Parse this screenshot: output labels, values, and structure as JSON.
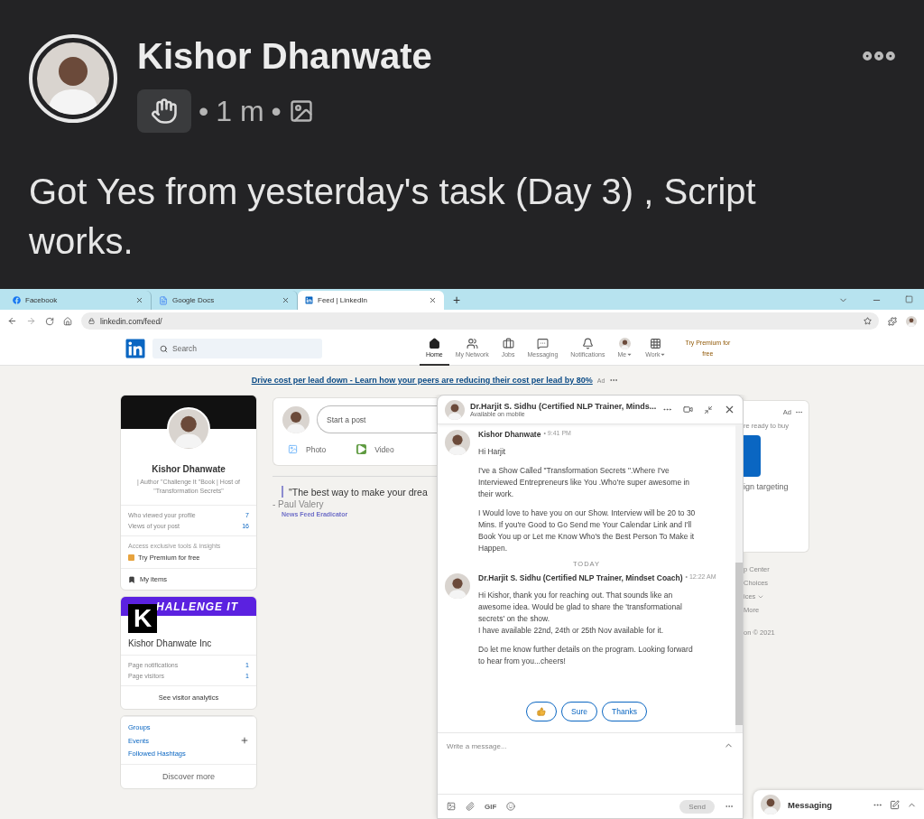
{
  "post": {
    "author": "Kishor Dhanwate",
    "separator": "•",
    "time": "1 m",
    "text": "Got Yes from yesterday's task (Day 3) , Script works."
  },
  "browser": {
    "tabs": [
      {
        "title": "Facebook",
        "kind": "facebook",
        "selected": false
      },
      {
        "title": "Google Docs",
        "kind": "docs",
        "selected": false
      },
      {
        "title": "Feed | LinkedIn",
        "kind": "linkedin",
        "selected": true
      }
    ],
    "new_tab": "+",
    "url": "linkedin.com/feed/"
  },
  "nav": {
    "search_placeholder": "Search",
    "items": [
      {
        "label": "Home",
        "kind": "home",
        "selected": true
      },
      {
        "label": "My Network",
        "kind": "network",
        "selected": false
      },
      {
        "label": "Jobs",
        "kind": "jobs",
        "selected": false
      },
      {
        "label": "Messaging",
        "kind": "messaging",
        "selected": false
      },
      {
        "label": "Notifications",
        "kind": "bell",
        "selected": false
      },
      {
        "label": "Me",
        "kind": "me",
        "selected": false
      },
      {
        "label": "Work",
        "kind": "work",
        "selected": false
      }
    ],
    "premium": [
      "Try Premium for",
      "free"
    ]
  },
  "ad_banner": {
    "link": "Drive cost per lead down - Learn how your peers are reducing their cost per lead by 80%",
    "badge": "Ad"
  },
  "profile_card": {
    "name": "Kishor Dhanwate",
    "headline": "| Author \"Challenge It \"Book | Host of \"Transformation Secrets\"",
    "stats": [
      {
        "label": "Who viewed your profile",
        "value": "7"
      },
      {
        "label": "Views of your post",
        "value": "16"
      }
    ],
    "premium_hint": "Access exclusive tools & insights",
    "premium_link": "Try Premium for free",
    "my_items": "My items"
  },
  "page_card": {
    "banner": "HALLENGE IT",
    "logo": "K",
    "name": "Kishor Dhanwate Inc",
    "stats": [
      {
        "label": "Page notifications",
        "value": "1"
      },
      {
        "label": "Page visitors",
        "value": "1"
      }
    ],
    "analytics": "See visitor analytics"
  },
  "links_card": {
    "links": [
      {
        "label": "Groups",
        "addable": false
      },
      {
        "label": "Events",
        "addable": true
      },
      {
        "label": "Followed Hashtags",
        "addable": false
      }
    ],
    "discover": "Discover more"
  },
  "composer": {
    "placeholder": "Start a post",
    "actions": [
      {
        "label": "Photo",
        "kind": "photo"
      },
      {
        "label": "Video",
        "kind": "video"
      }
    ]
  },
  "quote": {
    "text": "\"The best way to make your drea",
    "author": "- Paul Valery",
    "source": "News Feed Eradicator"
  },
  "chat": {
    "title": "Dr.Harjit S. Sidhu (Certified NLP Trainer, Minds...",
    "status": "Available on mobile",
    "earlier": [
      {
        "sender": "Kishor Dhanwate",
        "time": "• 9:41 PM",
        "blocks": [
          [
            "Hi Harjit"
          ],
          [
            "I've a Show Called \"Transformation Secrets \".Where I've Interviewed Entrepreneurs like You .Who're super awesome in their work."
          ],
          [
            "I Would love to have you on our Show. Interview will be 20 to 30 Mins. If you're Good to Go Send me Your Calendar Link and I'll Book You up or Let me Know Who's the Best Person To Make it Happen."
          ]
        ]
      }
    ],
    "day_divider": "TODAY",
    "today": [
      {
        "sender": "Dr.Harjit S. Sidhu (Certified NLP Trainer, Mindset Coach)",
        "time": "• 12:22 AM",
        "blocks": [
          [
            "Hi Kishor, thank you for reaching out. That sounds like an awesome idea. Would be glad to share the 'transformational secrets' on the show.",
            "I have available 22nd, 24th or 25th Nov available for it."
          ],
          [
            "Do let me know further details on the program. Looking forward to hear from you...cheers!"
          ]
        ]
      }
    ],
    "quick_replies": [
      {
        "kind": "like"
      },
      {
        "kind": "text",
        "label": "Sure"
      },
      {
        "kind": "text",
        "label": "Thanks"
      }
    ],
    "placeholder": "Write a message...",
    "gif_label": "GIF",
    "send": {
      "label": "Send",
      "disabled": true
    }
  },
  "right_column": {
    "ad_label": "Ad",
    "lines": [
      "re ready to buy",
      "ign targeting"
    ],
    "footer": [
      {
        "label": "p Center",
        "menu": false
      },
      {
        "label": "Choices",
        "menu": false
      },
      {
        "label": "ices",
        "menu": true
      },
      {
        "label": "More",
        "menu": false
      },
      {
        "label": "on © 2021",
        "menu": false
      }
    ]
  },
  "messaging_bar": {
    "label": "Messaging"
  }
}
